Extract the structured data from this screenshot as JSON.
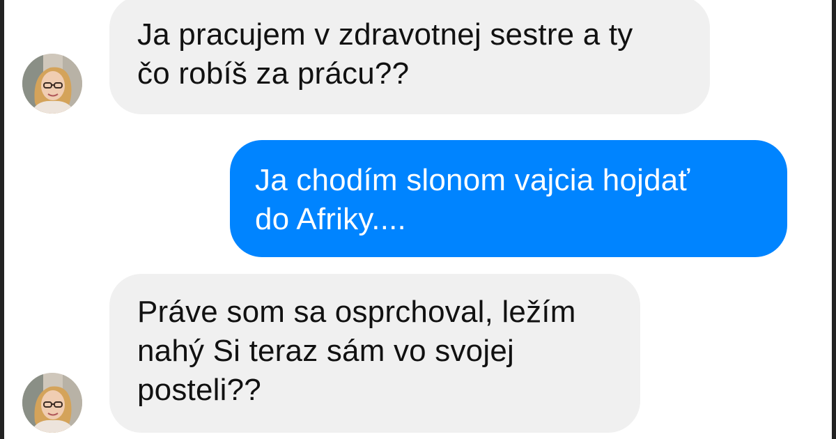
{
  "conversation": {
    "messages": [
      {
        "sender": "contact",
        "lines": [
          "Ja pracujem v zdravotnej sestre a ty",
          "čo robíš za prácu??"
        ]
      },
      {
        "sender": "me",
        "lines": [
          "Ja chodím slonom vajcia hojdať",
          "do Afriky...."
        ]
      },
      {
        "sender": "contact",
        "lines": [
          "Práve som sa osprchoval, ležím",
          "nahý Si teraz sám vo svojej",
          "posteli??"
        ]
      }
    ]
  },
  "colors": {
    "incoming_bubble": "#f0f0f0",
    "outgoing_bubble": "#0084ff",
    "incoming_text": "#111111",
    "outgoing_text": "#ffffff"
  },
  "icons": {
    "contact_avatar": "avatar-photo-icon"
  }
}
